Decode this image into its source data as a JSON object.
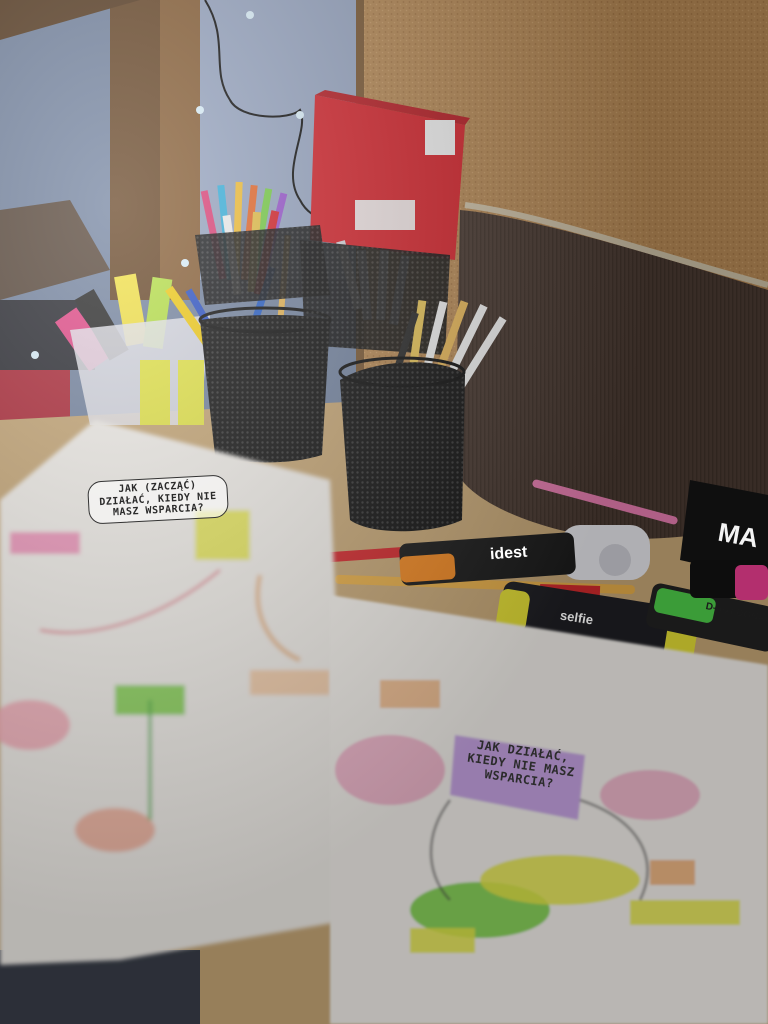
{
  "scene": {
    "description_tag": "desk-with-stationery-and-mind-maps"
  },
  "notes": {
    "left_sheet_heading": "JAK (ZACZĄĆ) DZIAŁAĆ, KIEDY NIE MASZ WSPARCIA?",
    "right_sheet_heading": "JAK DZIAŁAĆ, KIEDY NIE MASZ WSPARCIA?"
  },
  "products": {
    "highlighter_orange_brand": "idest",
    "highlighter_yellow_brand": "selfie",
    "highlighter_green_brand": "D-text DONAU",
    "marker_box_text": "MA"
  },
  "colors": {
    "desk": "#c9a978",
    "cork": "#b58a55",
    "wall": "#7f8ea8",
    "pouch": "#4a3a33",
    "box_red": "#d4232b",
    "sticky_purple": "#c9a6e6",
    "highlight_green": "#7fd24a",
    "highlight_yellow": "#e8e94a",
    "highlight_pink": "#f08ab6",
    "highlight_orange": "#f2a15b"
  }
}
